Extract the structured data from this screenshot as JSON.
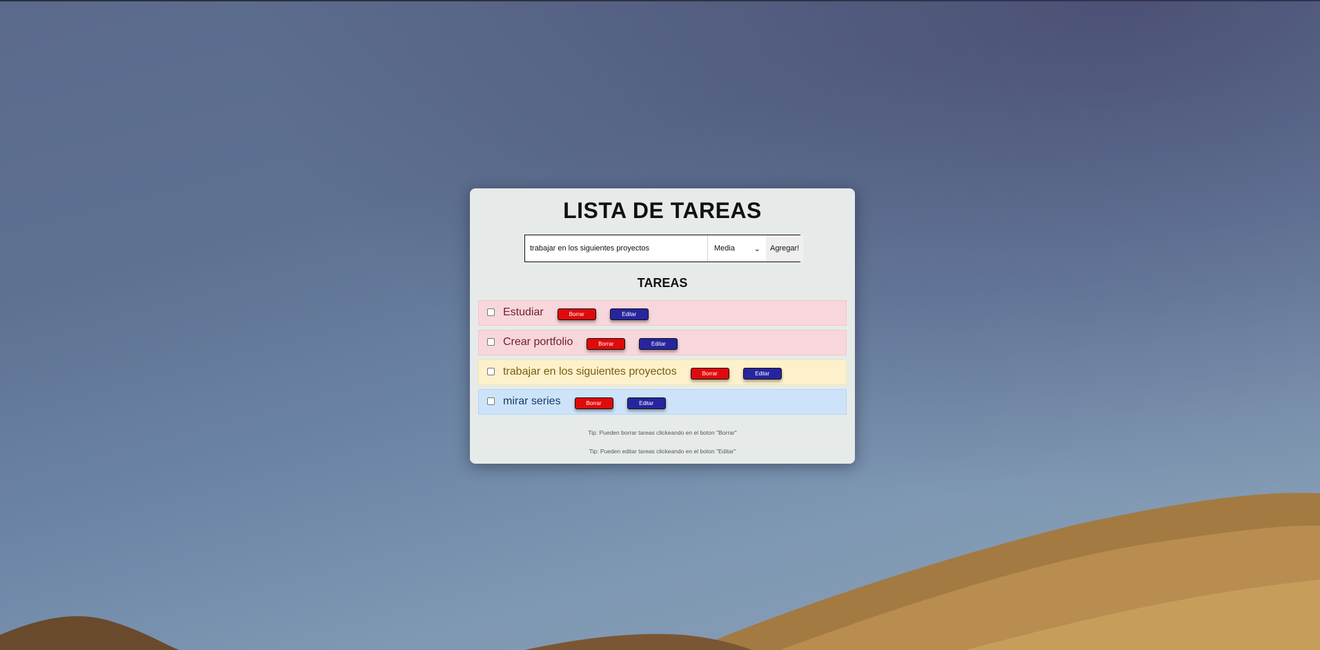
{
  "app": {
    "title": "LISTA DE TAREAS",
    "list_heading": "TAREAS"
  },
  "form": {
    "input_value": "trabajar en los siguientes proyectos",
    "priority_selected": "Media",
    "add_label": "Agregar!"
  },
  "tasks": [
    {
      "text": "Estudiar",
      "priority": "high",
      "checked": false,
      "delete_label": "Borrar",
      "edit_label": "Editar"
    },
    {
      "text": "Crear portfolio",
      "priority": "high",
      "checked": false,
      "delete_label": "Borrar",
      "edit_label": "Editar"
    },
    {
      "text": "trabajar en los siguientes proyectos",
      "priority": "medium",
      "checked": false,
      "delete_label": "Borrar",
      "edit_label": "Editar"
    },
    {
      "text": "mirar series",
      "priority": "low",
      "checked": false,
      "delete_label": "Borrar",
      "edit_label": "Editar"
    }
  ],
  "tips": [
    "Tip: Pueden borrar tareas clickeando en el boton \"Borrar\"",
    "Tip: Pueden editar tareas clickeando en el boton \"Editar\""
  ],
  "colors": {
    "high_bg": "#f7d7dc",
    "medium_bg": "#fdf1cc",
    "low_bg": "#cde3f9",
    "delete_button": "#e00a0a",
    "edit_button": "#27259e"
  }
}
